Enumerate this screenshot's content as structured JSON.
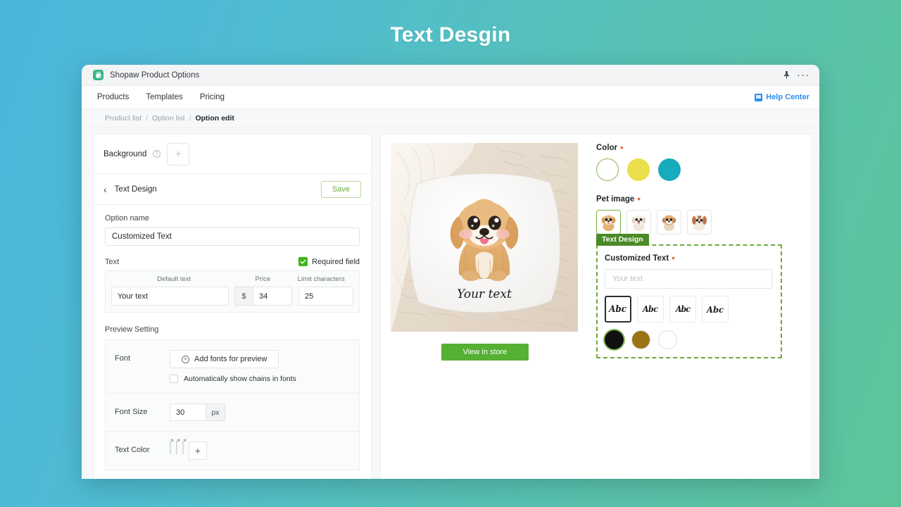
{
  "page": {
    "title": "Text Desgin",
    "bg_gradient_from": "#4ab6dc",
    "bg_gradient_to": "#5ec49a"
  },
  "window": {
    "app_name": "Shopaw Product Options",
    "logo_icon": "shopping-bag-icon",
    "pin_icon": "pin-icon",
    "more_icon": "more-horizontal-icon"
  },
  "nav": {
    "items": [
      {
        "label": "Products"
      },
      {
        "label": "Templates"
      },
      {
        "label": "Pricing"
      }
    ],
    "help": {
      "label": "Help Center",
      "icon": "help-center-icon",
      "color": "#2a8df0"
    }
  },
  "breadcrumb": {
    "items": [
      {
        "label": "Product list",
        "current": false
      },
      {
        "label": "Option list",
        "current": false
      },
      {
        "label": "Option edit",
        "current": true
      }
    ],
    "separator": "/"
  },
  "editor": {
    "background": {
      "label": "Background",
      "help_icon": "question-circle-icon",
      "add_icon": "plus-icon"
    },
    "section": {
      "back_icon": "chevron-left-icon",
      "title": "Text Design",
      "save_label": "Save",
      "save_color": "#6aab3e"
    },
    "option_name": {
      "label": "Option name",
      "value": "Customized Text",
      "placeholder": "Option name"
    },
    "text_table": {
      "label": "Text",
      "required_label": "Required field",
      "required_checked": true,
      "columns": [
        "Default text",
        "Price",
        "Limit characters"
      ],
      "row": {
        "default_text": "Your text",
        "currency": "$",
        "price": "34",
        "limit_characters": "25"
      }
    },
    "preview_setting": {
      "title": "Preview Setting",
      "font": {
        "label": "Font",
        "add_button": "Add fonts for preview",
        "add_icon": "plus-circle-icon",
        "auto_label": "Automatically show chains in fonts",
        "auto_checked": false
      },
      "font_size": {
        "label": "Font Size",
        "value": "30",
        "unit": "px"
      },
      "text_color": {
        "label": "Text Color",
        "swatches": [
          "#101010",
          "#9a7412",
          "#ffffff"
        ],
        "remove_icon": "close-icon",
        "add_icon": "plus-icon"
      }
    }
  },
  "preview": {
    "product_alt": "white pillow with puppy print and script text",
    "pillow_text": "Your text",
    "view_in_store": "View in store",
    "view_button_color": "#56b033"
  },
  "options": {
    "color": {
      "label": "Color",
      "required": true,
      "swatches": [
        {
          "hex": "#ffffff",
          "selected": true
        },
        {
          "hex": "#ebdf4b",
          "selected": false
        },
        {
          "hex": "#16abbd",
          "selected": false
        }
      ]
    },
    "pet_image": {
      "label": "Pet image",
      "required": true,
      "items": [
        {
          "name": "golden-puppy",
          "selected": true
        },
        {
          "name": "cream-puppy",
          "selected": false
        },
        {
          "name": "tan-puppy",
          "selected": false
        },
        {
          "name": "spaniel-puppy",
          "selected": false
        }
      ]
    },
    "text_design": {
      "tag": "Text Design",
      "label": "Customized Text",
      "required": true,
      "input_value": "",
      "input_placeholder": "Your text",
      "fonts": [
        {
          "sample": "Abc",
          "selected": true
        },
        {
          "sample": "Abc",
          "selected": false
        },
        {
          "sample": "Abc",
          "selected": false
        },
        {
          "sample": "Abc",
          "selected": false
        }
      ],
      "colors": [
        {
          "hex": "#111111",
          "selected": true
        },
        {
          "hex": "#9a7412",
          "selected": false
        },
        {
          "hex": "#ffffff",
          "selected": false
        }
      ]
    }
  }
}
